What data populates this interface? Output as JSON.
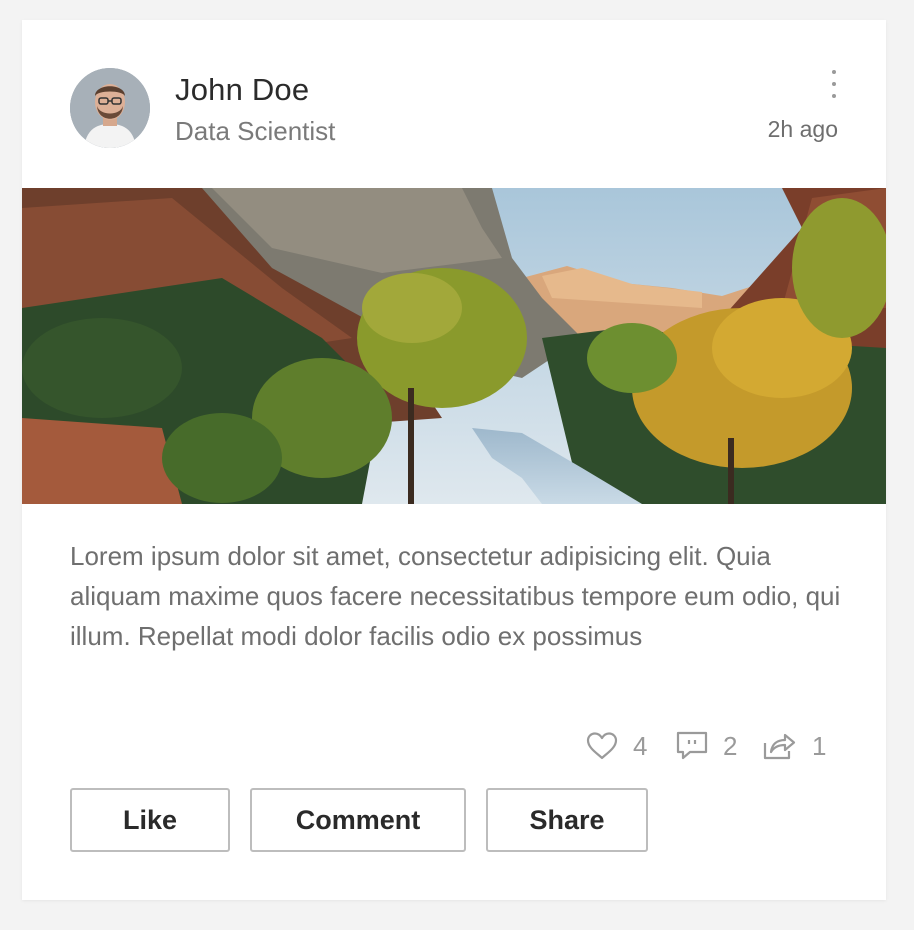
{
  "post": {
    "author": "John Doe",
    "role": "Data Scientist",
    "time": "2h ago",
    "body": "Lorem ipsum dolor sit amet, consectetur adipisicing elit. Quia aliquam maxime quos facere necessitatibus tempore eum odio, qui illum. Repellat modi dolor facilis odio ex possimus",
    "stats": {
      "likes": "4",
      "comments": "2",
      "shares": "1"
    },
    "actions": {
      "like": "Like",
      "comment": "Comment",
      "share": "Share"
    }
  },
  "icons": {
    "more": "more-vertical-icon",
    "like": "heart-icon",
    "comment": "comment-icon",
    "share": "share-icon"
  },
  "colors": {
    "text_primary": "#2b2b2b",
    "text_muted": "#7a7a7a",
    "icon": "#9a9a9a",
    "button_border": "#bdbdbd"
  }
}
